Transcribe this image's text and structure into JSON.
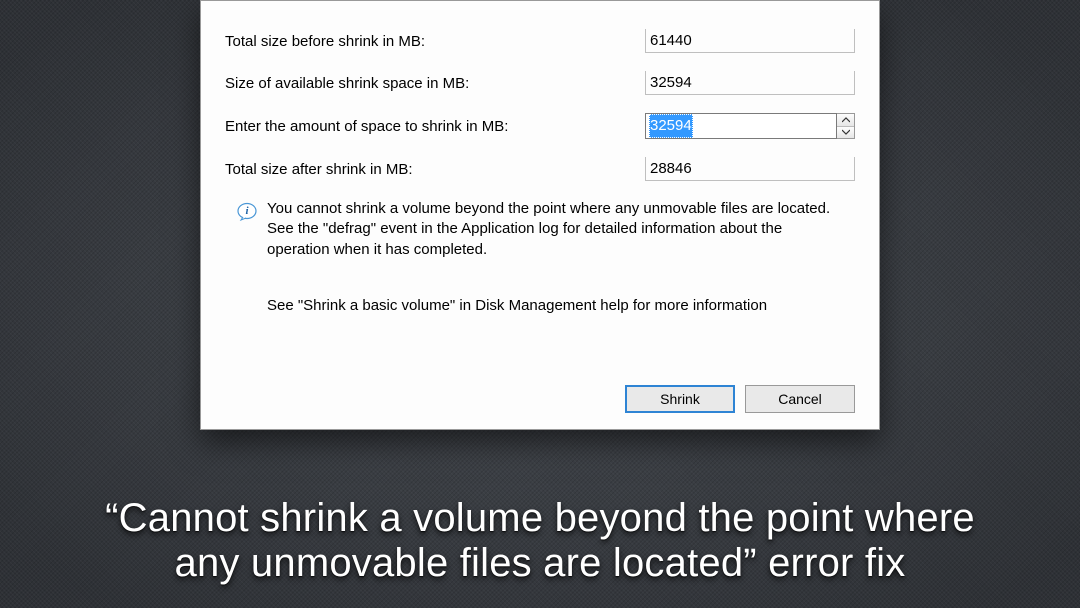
{
  "dialog": {
    "rows": {
      "totalBefore": {
        "label": "Total size before shrink in MB:",
        "value": "61440"
      },
      "available": {
        "label": "Size of available shrink space in MB:",
        "value": "32594"
      },
      "enter": {
        "label": "Enter the amount of space to shrink in MB:",
        "value": "32594"
      },
      "totalAfter": {
        "label": "Total size after shrink in MB:",
        "value": "28846"
      }
    },
    "info": "You cannot shrink a volume beyond the point where any unmovable files are located. See the \"defrag\" event in the Application log for detailed information about the operation when it has completed.",
    "see": "See \"Shrink a basic volume\" in Disk Management help for more information",
    "buttons": {
      "shrink": "Shrink",
      "cancel": "Cancel"
    }
  },
  "caption": {
    "line1": "“Cannot shrink a volume beyond the point where",
    "line2": "any unmovable files are located” error fix"
  }
}
